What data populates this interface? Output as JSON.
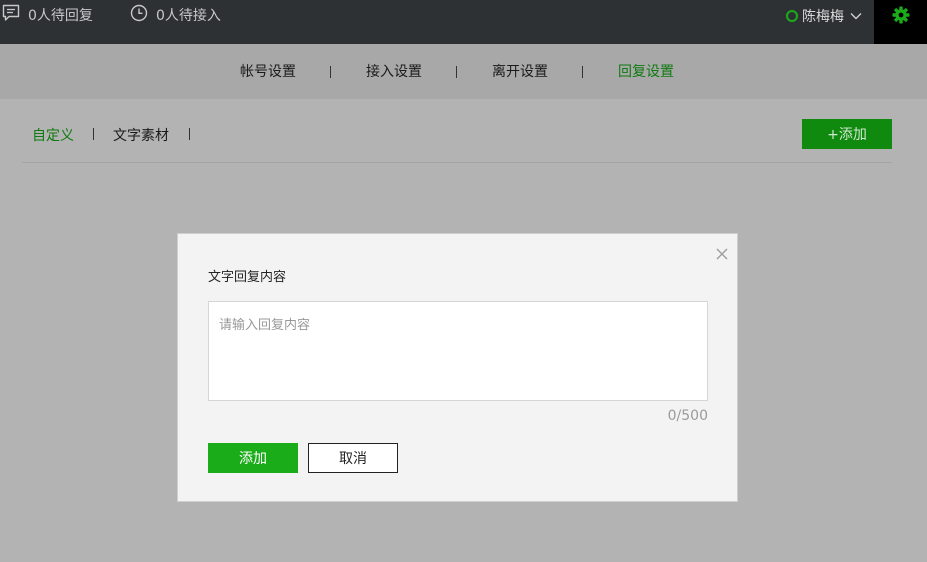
{
  "topbar": {
    "pending_reply": "0人待回复",
    "pending_access": "0人待接入",
    "user_name": "陈梅梅",
    "status_color": "#1aad19",
    "icons": [
      "chat-icon",
      "clock-icon",
      "online-status-icon",
      "chevron-down-icon",
      "gear-icon"
    ]
  },
  "nav": {
    "tabs": [
      {
        "label": "帐号设置",
        "active": false
      },
      {
        "label": "接入设置",
        "active": false
      },
      {
        "label": "离开设置",
        "active": false
      },
      {
        "label": "回复设置",
        "active": true
      }
    ],
    "active_color": "#0f7a0f"
  },
  "content": {
    "tabs": [
      {
        "label": "自定义",
        "active": true
      },
      {
        "label": "文字素材",
        "active": false
      }
    ],
    "add_button": "+添加"
  },
  "dialog": {
    "title": "文字回复内容",
    "input_value": "",
    "placeholder": "请输入回复内容",
    "counter": "0/500",
    "confirm_label": "添加",
    "cancel_label": "取消",
    "accent_color": "#1aad19"
  }
}
